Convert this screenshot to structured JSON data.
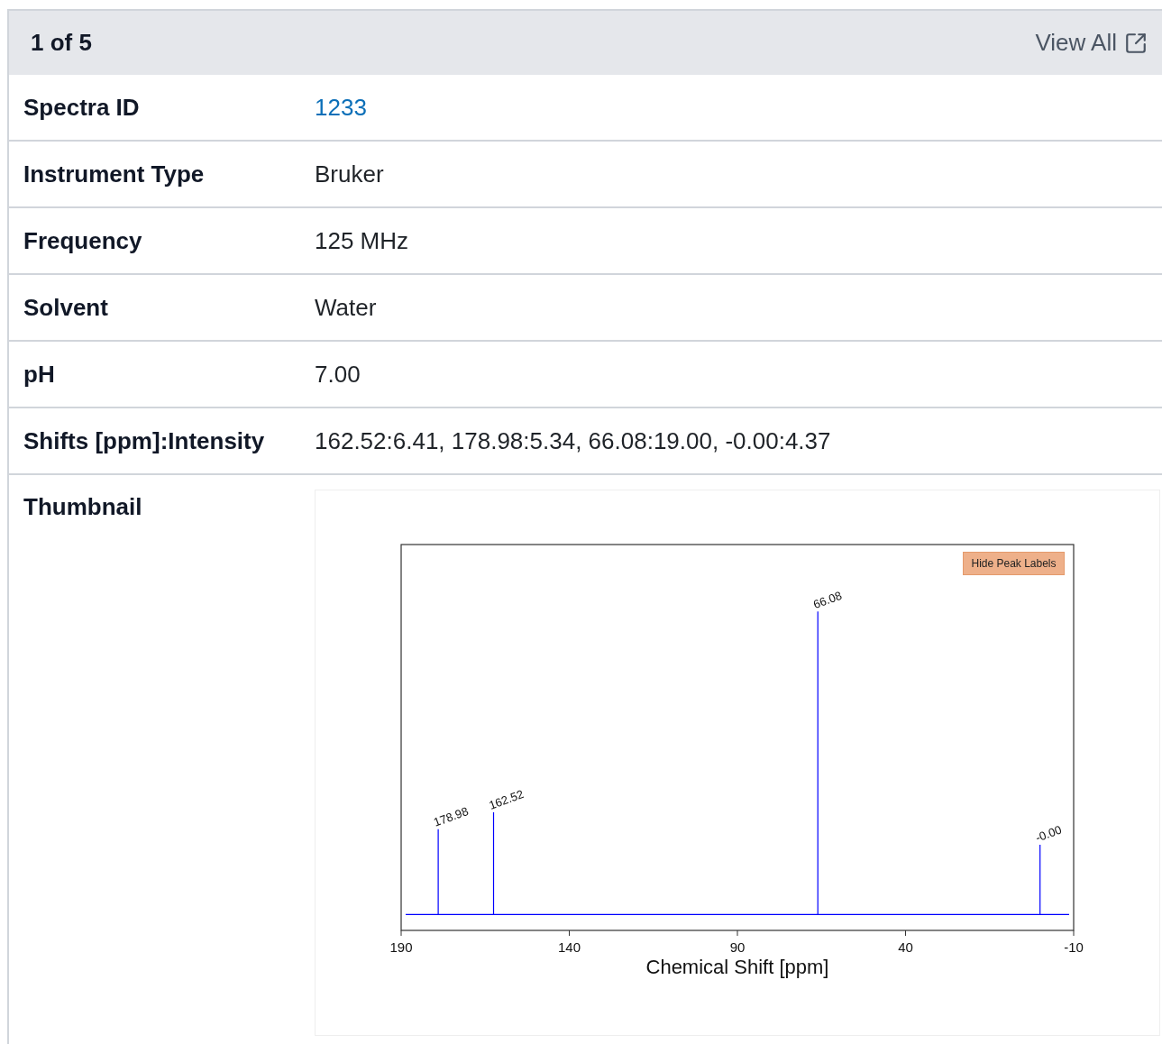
{
  "header": {
    "pager": "1 of 5",
    "view_all": "View All"
  },
  "rows": [
    {
      "label": "Spectra ID",
      "value": "1233",
      "kind": "link"
    },
    {
      "label": "Instrument Type",
      "value": "Bruker",
      "kind": "text"
    },
    {
      "label": "Frequency",
      "value": "125 MHz",
      "kind": "text"
    },
    {
      "label": "Solvent",
      "value": "Water",
      "kind": "text"
    },
    {
      "label": "pH",
      "value": "7.00",
      "kind": "text"
    },
    {
      "label": "Shifts [ppm]:Intensity",
      "value": "162.52:6.41, 178.98:5.34, 66.08:19.00, -0.00:4.37",
      "kind": "text"
    }
  ],
  "thumbnail": {
    "label": "Thumbnail",
    "button": "Hide Peak Labels",
    "spectrum": {
      "x_title": "Chemical Shift [ppm]",
      "x_ticks": [
        "190",
        "140",
        "90",
        "40",
        "-10"
      ],
      "peak_labels": [
        "178.98",
        "162.52",
        "66.08",
        "-0.00"
      ]
    }
  }
}
